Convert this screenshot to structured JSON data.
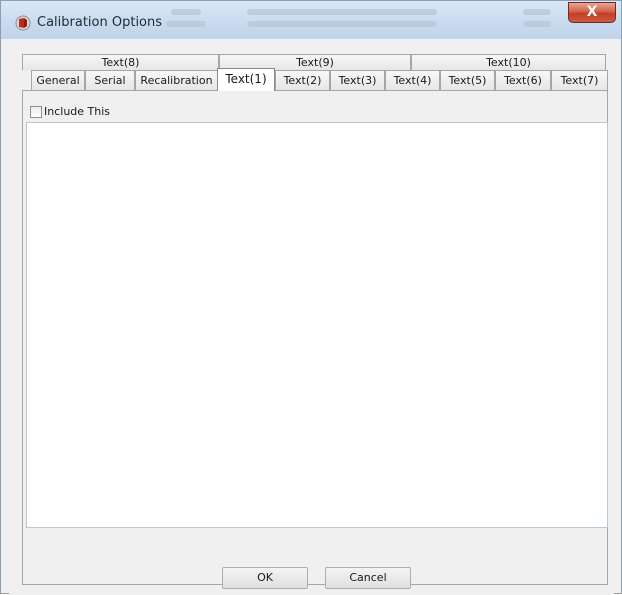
{
  "window": {
    "title": "Calibration Options",
    "close_glyph": "X"
  },
  "tabs": {
    "row_back": [
      {
        "label": "Text(8)"
      },
      {
        "label": "Text(9)"
      },
      {
        "label": "Text(10)"
      }
    ],
    "row_front": [
      {
        "label": "General"
      },
      {
        "label": "Serial"
      },
      {
        "label": "Recalibration"
      },
      {
        "label": "Text(1)",
        "active": true
      },
      {
        "label": "Text(2)"
      },
      {
        "label": "Text(3)"
      },
      {
        "label": "Text(4)"
      },
      {
        "label": "Text(5)"
      },
      {
        "label": "Text(6)"
      },
      {
        "label": "Text(7)"
      }
    ]
  },
  "panel": {
    "checkbox_label": "Include This",
    "checkbox_checked": false,
    "text_value": ""
  },
  "buttons": {
    "ok": "OK",
    "cancel": "Cancel"
  },
  "colors": {
    "close_button": "#c8452b",
    "title_bar": "#c9dbef"
  }
}
